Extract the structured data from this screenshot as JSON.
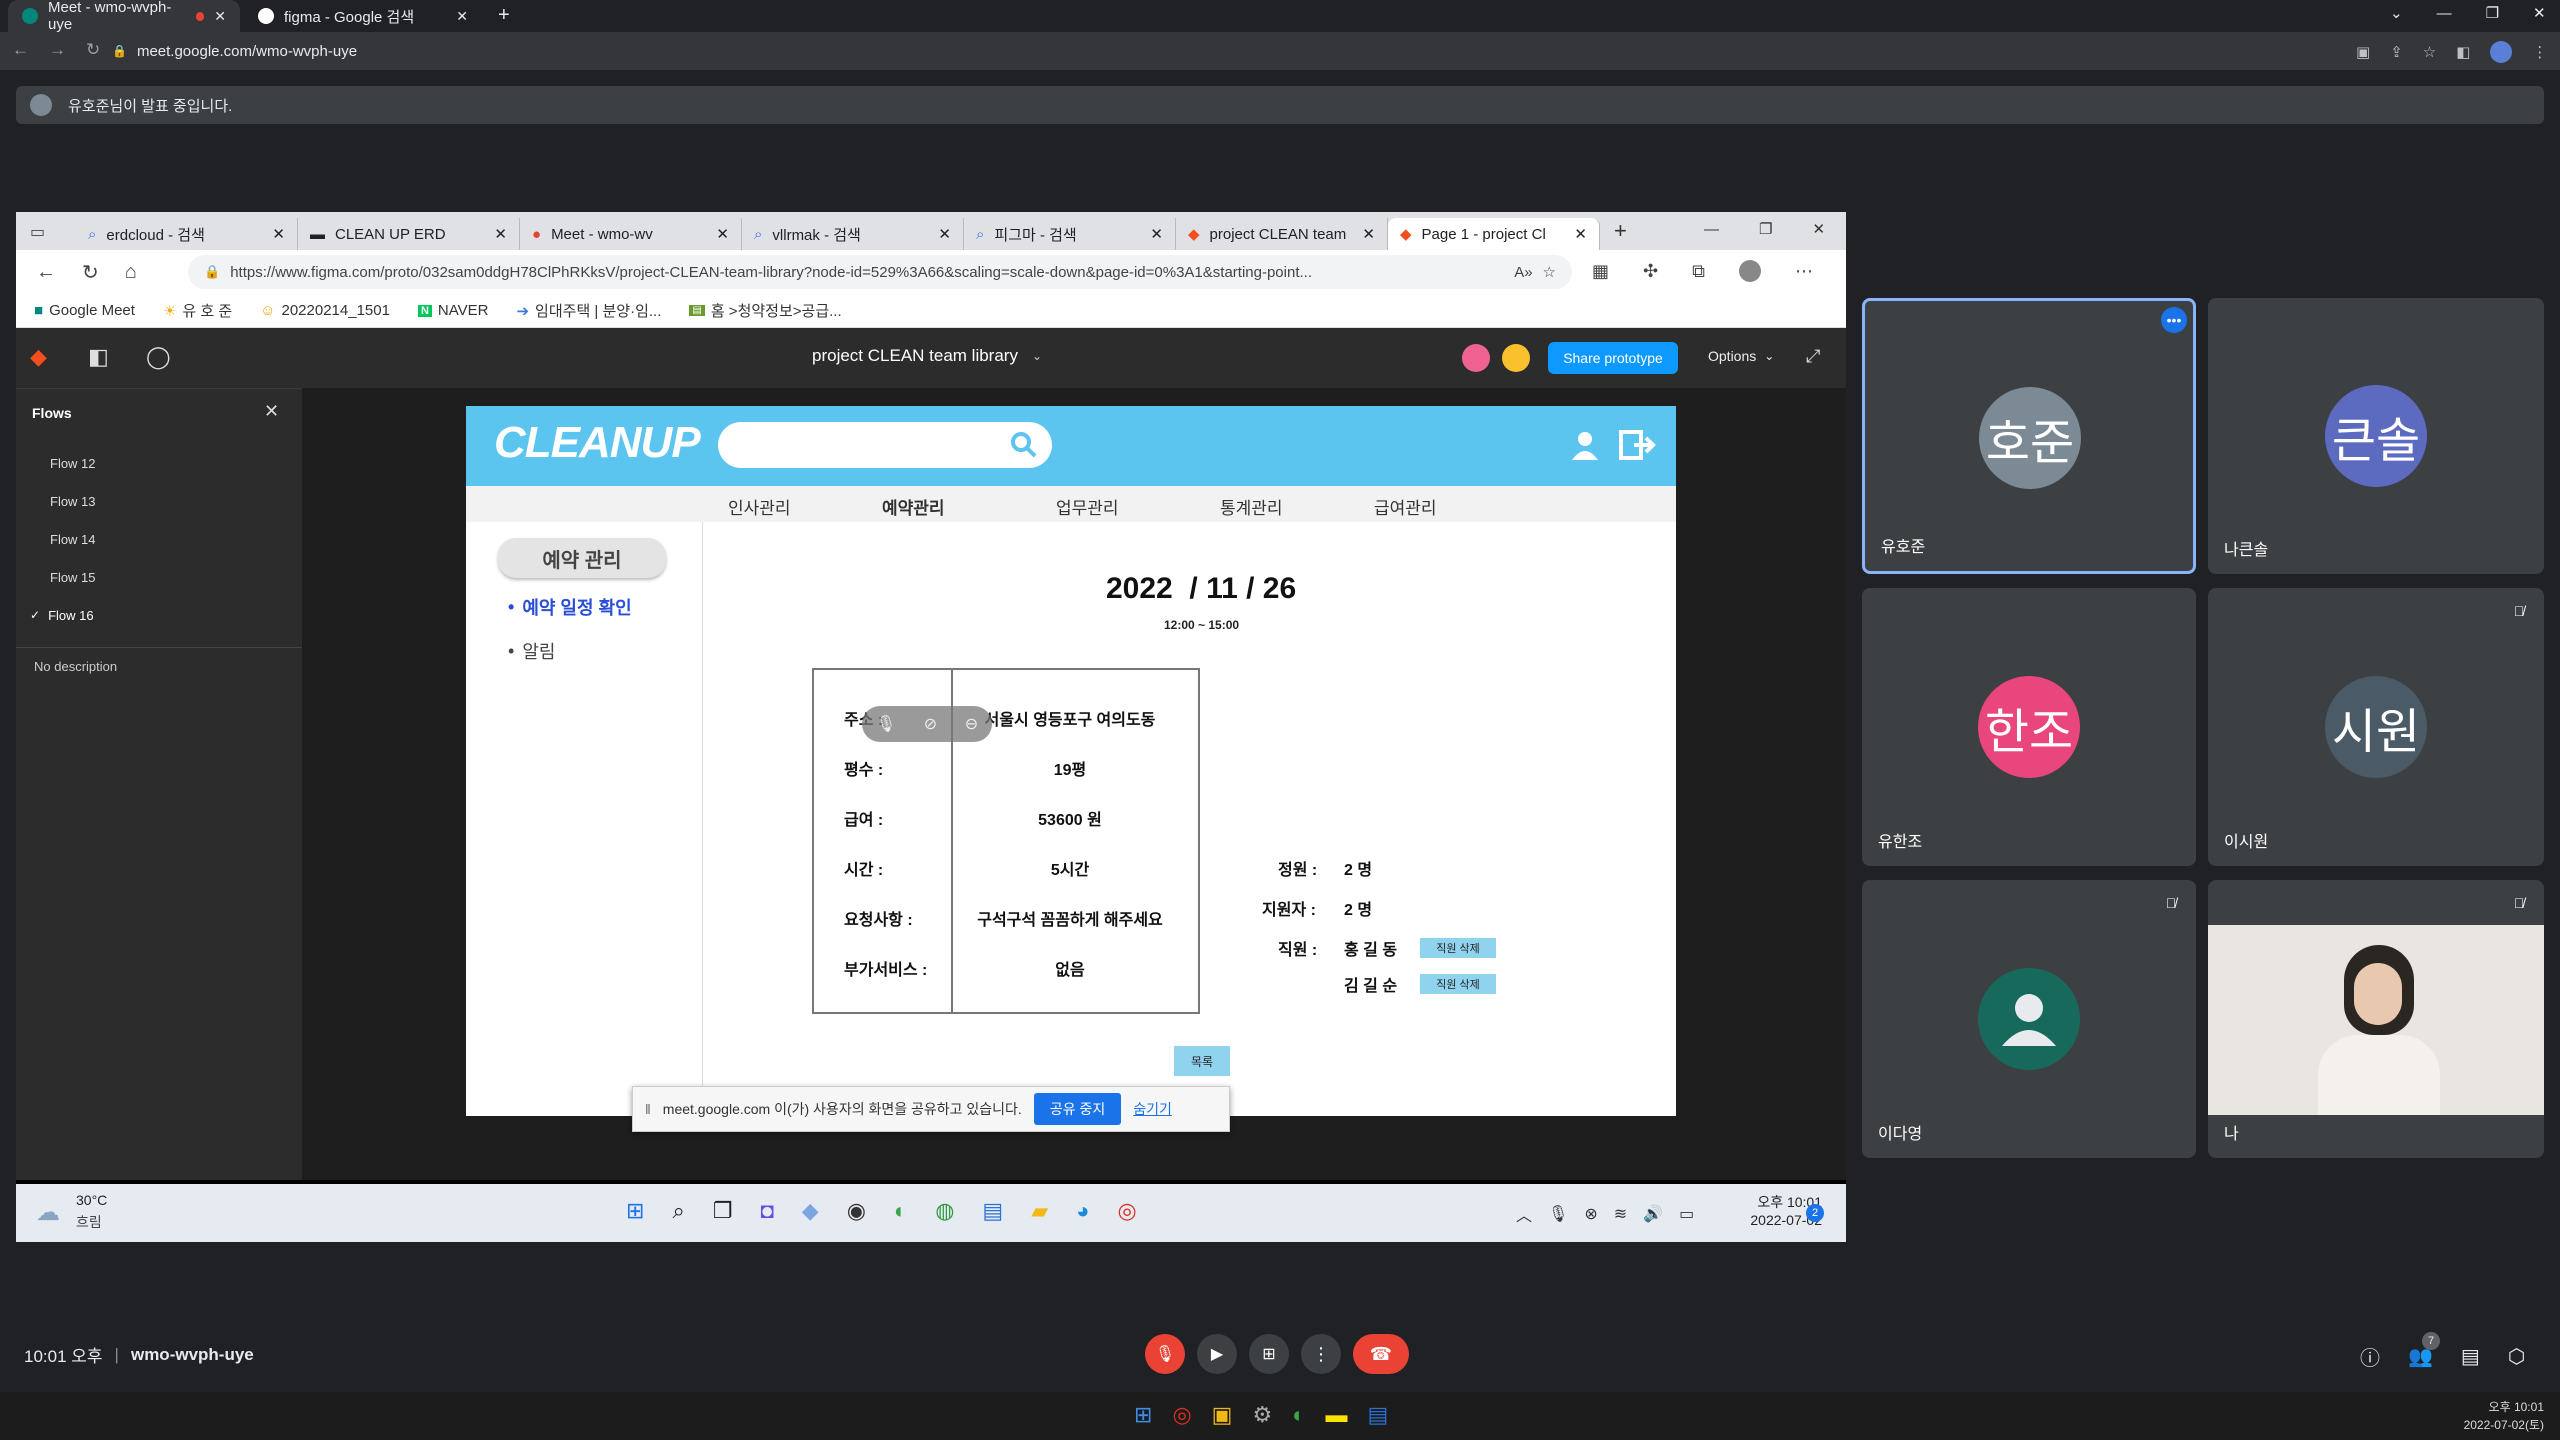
{
  "outer_browser": {
    "tabs": [
      {
        "label": "Meet - wmo-wvph-uye"
      },
      {
        "label": "figma - Google 검색"
      }
    ],
    "url": "meet.google.com/wmo-wvph-uye"
  },
  "presenting_banner": {
    "text": "유호준님이 발표 중입니다."
  },
  "shared_browser": {
    "tabs": [
      {
        "label": "erdcloud - 검색"
      },
      {
        "label": "CLEAN UP ERD"
      },
      {
        "label": "Meet - wmo-wv"
      },
      {
        "label": "vllrmak - 검색"
      },
      {
        "label": "피그마 - 검색"
      },
      {
        "label": "project CLEAN team li"
      },
      {
        "label": "Page 1 - project Cl"
      }
    ],
    "url": "https://www.figma.com/proto/032sam0ddgH78ClPhRKksV/project-CLEAN-team-library?node-id=529%3A66&scaling=scale-down&page-id=0%3A1&starting-point...",
    "bookmarks": [
      "Google Meet",
      "유 호 준",
      "20220214_1501",
      "NAVER",
      "임대주택 | 분양·임...",
      "홈 >청약정보>공급..."
    ]
  },
  "figma": {
    "file_title": "project CLEAN team library",
    "share_button": "Share prototype",
    "options_label": "Options",
    "flows_title": "Flows",
    "flows": [
      "Flow 12",
      "Flow 13",
      "Flow 14",
      "Flow 15",
      "Flow 16"
    ],
    "selected_flow": "Flow 16",
    "no_description": "No description"
  },
  "cleanup": {
    "logo": "CLEANUP",
    "nav": [
      "인사관리",
      "예약관리",
      "업무관리",
      "통계관리",
      "급여관리"
    ],
    "active_nav": "예약관리",
    "side_title": "예약 관리",
    "side_items": [
      "예약 일정 확인",
      "알림"
    ],
    "date": "2022  / 11 / 26",
    "time": "12:00 ~ 15:00",
    "details": [
      {
        "label": "주소 :",
        "value": "서울시 영등포구 여의도동"
      },
      {
        "label": "평수 :",
        "value": "19평"
      },
      {
        "label": "급여 :",
        "value": "53600 원"
      },
      {
        "label": "시간 :",
        "value": "5시간"
      },
      {
        "label": "요청사항 :",
        "value": "구석구석 꼼꼼하게 해주세요"
      },
      {
        "label": "부가서비스 :",
        "value": "없음"
      }
    ],
    "quota_label": "정원 :",
    "quota_value": "2 명",
    "applicants_label": "지원자 :",
    "applicants_value": "2 명",
    "staff_label": "직원 :",
    "staff": [
      "홍 길 동",
      "김 길 순"
    ],
    "delete_label": "직원 삭제",
    "list_button": "목록"
  },
  "share_notice": {
    "text": "meet.google.com 이(가) 사용자의 화면을 공유하고 있습니다.",
    "stop": "공유 중지",
    "hide": "숨기기"
  },
  "inner_taskbar": {
    "weather_temp": "30°C",
    "weather_desc": "흐림",
    "time": "오후 10:01",
    "date": "2022-07-02",
    "badge": "2"
  },
  "participants": [
    {
      "name": "유호준",
      "initials": "호준",
      "color": "#7b8a94"
    },
    {
      "name": "나큰솔",
      "initials": "큰솔",
      "color": "#5c6bc0"
    },
    {
      "name": "유한조",
      "initials": "한조",
      "color": "#e8467c"
    },
    {
      "name": "이시원",
      "initials": "시원",
      "color": "#4a5a66"
    },
    {
      "name": "이다영",
      "initials": "",
      "color": "#17695c"
    },
    {
      "name": "나",
      "initials": ""
    }
  ],
  "meet_bottom": {
    "time": "10:01 오후",
    "meeting_code": "wmo-wvph-uye",
    "people_count": "7"
  },
  "os_clock": {
    "time": "오후 10:01",
    "date": "2022-07-02(토)"
  }
}
